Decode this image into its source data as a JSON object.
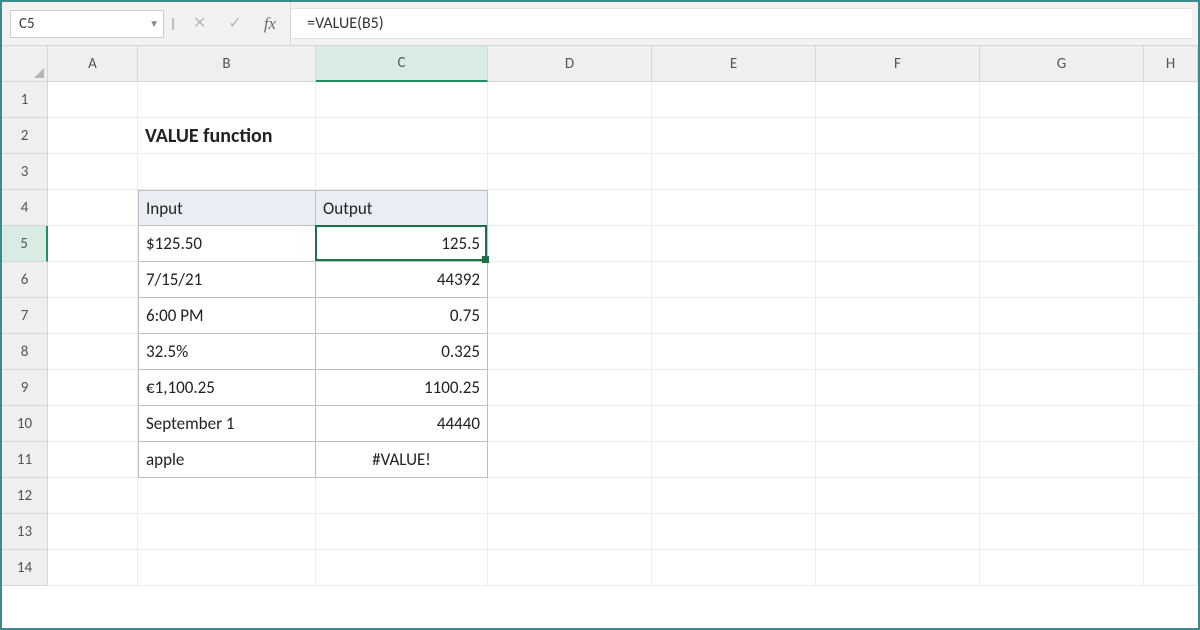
{
  "nameBox": "C5",
  "formulaBar": "=VALUE(B5)",
  "columns": [
    "A",
    "B",
    "C",
    "D",
    "E",
    "F",
    "G",
    "H"
  ],
  "activeCol": "C",
  "activeRow": 5,
  "rowCount": 14,
  "title": "VALUE function",
  "table": {
    "headers": {
      "input": "Input",
      "output": "Output"
    },
    "rows": [
      {
        "input": "$125.50",
        "output": "125.5",
        "outAlign": "right"
      },
      {
        "input": "7/15/21",
        "output": "44392",
        "outAlign": "right"
      },
      {
        "input": "6:00 PM",
        "output": "0.75",
        "outAlign": "right"
      },
      {
        "input": "32.5%",
        "output": "0.325",
        "outAlign": "right"
      },
      {
        "input": "€1,100.25",
        "output": "1100.25",
        "outAlign": "right"
      },
      {
        "input": "September 1",
        "output": "44440",
        "outAlign": "right"
      },
      {
        "input": "apple",
        "output": "#VALUE!",
        "outAlign": "center"
      }
    ]
  },
  "icons": {
    "cancel": "✕",
    "enter": "✓",
    "fx": "fx"
  }
}
